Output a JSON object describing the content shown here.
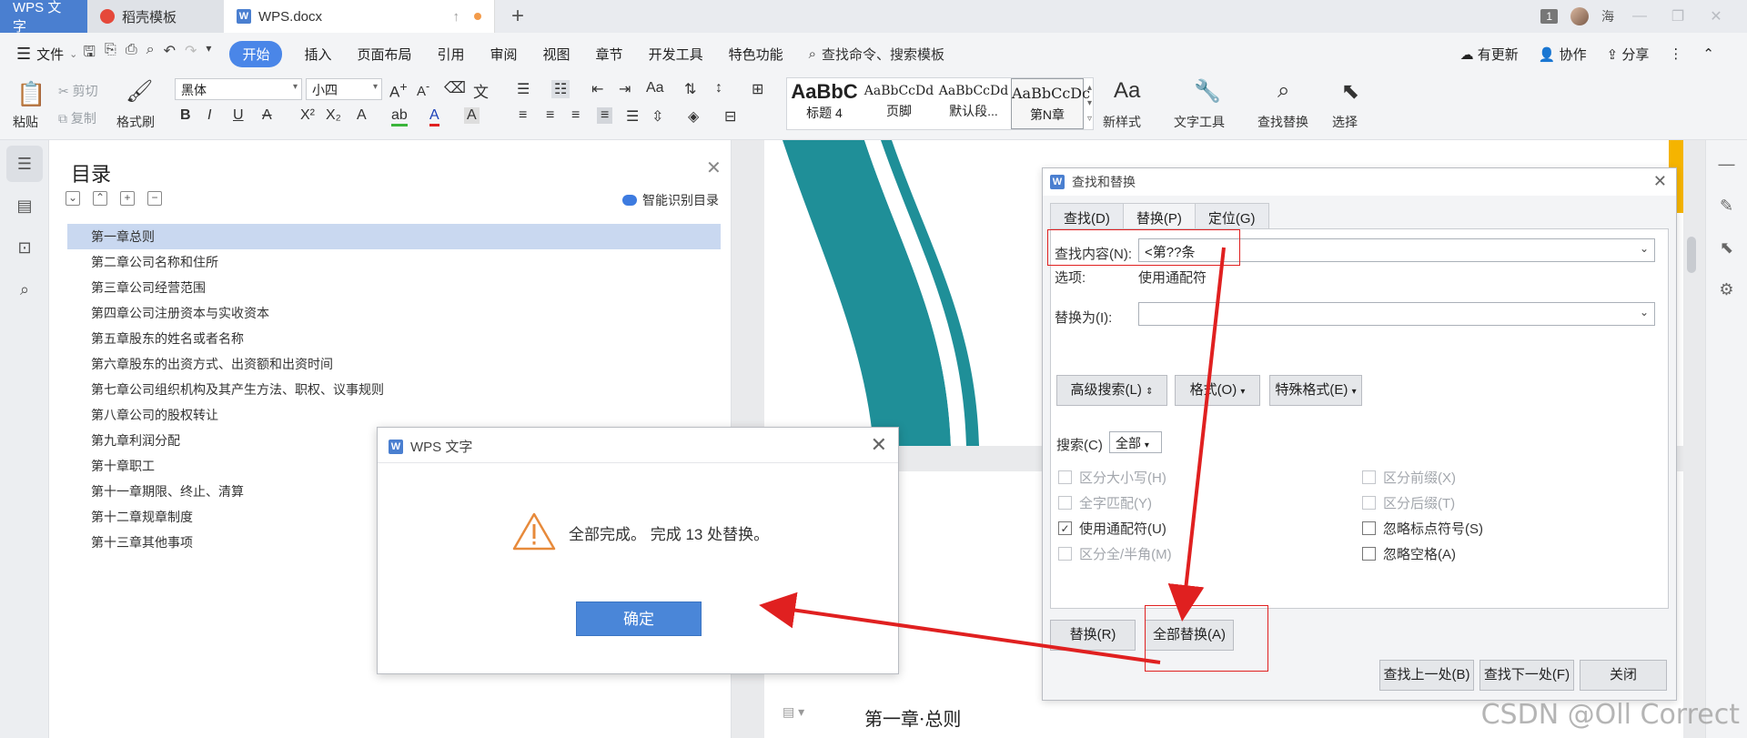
{
  "titlebar": {
    "brand_tab": "WPS 文字",
    "template_tab": "稻壳模板",
    "doc_tab": "WPS.docx",
    "window_count": "1",
    "user": "海"
  },
  "menubar": {
    "file": "文件",
    "items": [
      "开始",
      "插入",
      "页面布局",
      "引用",
      "审阅",
      "视图",
      "章节",
      "开发工具",
      "特色功能"
    ],
    "search": "查找命令、搜索模板",
    "update": "有更新",
    "collab": "协作",
    "share": "分享"
  },
  "ribbon": {
    "paste": "粘贴",
    "cut": "剪切",
    "copy": "复制",
    "format_painter": "格式刷",
    "font_name": "黑体",
    "font_size": "小四",
    "styles": [
      {
        "preview": "AaBbC",
        "name": "标题 4"
      },
      {
        "preview": "AaBbCcDd",
        "name": "页脚"
      },
      {
        "preview": "AaBbCcDd",
        "name": "默认段..."
      },
      {
        "preview": "AaBbCcDc",
        "name": "第N章"
      }
    ],
    "new_style": "新样式",
    "text_tools": "文字工具",
    "find_replace": "查找替换",
    "select": "选择"
  },
  "toc": {
    "title": "目录",
    "smart": "智能识别目录",
    "items": [
      "第一章总则",
      "第二章公司名称和住所",
      "第三章公司经营范围",
      "第四章公司注册资本与实收资本",
      "第五章股东的姓名或者名称",
      "第六章股东的出资方式、出资额和出资时间",
      "第七章公司组织机构及其产生方法、职权、议事规则",
      "第八章公司的股权转让",
      "第九章利润分配",
      "第十章职工",
      "第十一章期限、终止、清算",
      "第十二章规章制度",
      "第十三章其他事项"
    ]
  },
  "document": {
    "heading": "第一章·总则"
  },
  "find_replace": {
    "title": "查找和替换",
    "tabs": [
      "查找(D)",
      "替换(P)",
      "定位(G)"
    ],
    "find_label": "查找内容(N):",
    "find_value": "<第??条",
    "options_label": "选项:",
    "options_value": "使用通配符",
    "replace_label": "替换为(I):",
    "replace_value": "",
    "advanced": "高级搜索(L)",
    "format": "格式(O)",
    "special": "特殊格式(E)",
    "search_label": "搜索(C)",
    "search_scope": "全部",
    "checkboxes_left": [
      {
        "label": "区分大小写(H)",
        "checked": false,
        "disabled": true
      },
      {
        "label": "全字匹配(Y)",
        "checked": false,
        "disabled": true
      },
      {
        "label": "使用通配符(U)",
        "checked": true,
        "disabled": false
      },
      {
        "label": "区分全/半角(M)",
        "checked": false,
        "disabled": true
      }
    ],
    "checkboxes_right": [
      {
        "label": "区分前缀(X)",
        "checked": false,
        "disabled": true
      },
      {
        "label": "区分后缀(T)",
        "checked": false,
        "disabled": true
      },
      {
        "label": "忽略标点符号(S)",
        "checked": false,
        "disabled": false
      },
      {
        "label": "忽略空格(A)",
        "checked": false,
        "disabled": false
      }
    ],
    "replace_btn": "替换(R)",
    "replace_all_btn": "全部替换(A)",
    "find_prev": "查找上一处(B)",
    "find_next": "查找下一处(F)",
    "close": "关闭"
  },
  "message": {
    "title": "WPS 文字",
    "text": "全部完成。 完成 13 处替换。",
    "ok": "确定"
  },
  "watermark": "CSDN @Oll Correct",
  "colors": {
    "accent": "#4a86e8",
    "annotation": "#e02020"
  }
}
